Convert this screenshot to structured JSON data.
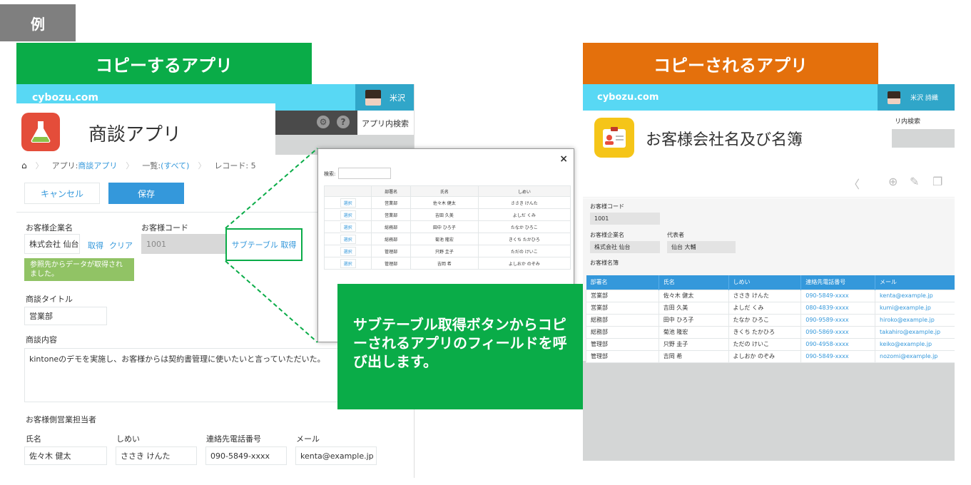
{
  "example_tag": "例",
  "left_banner": "コピーするアプリ",
  "right_banner": "コピーされるアプリ",
  "left_app": {
    "brand": "cybozu.com",
    "user": "米沢",
    "search_label": "アプリ内検索",
    "app_name": "商談アプリ",
    "breadcrumb": {
      "app_label": "アプリ:",
      "app_link": "商談アプリ",
      "list_label": "一覧:",
      "list_link": "(すべて)",
      "record": "レコード: 5"
    },
    "cancel": "キャンセル",
    "save": "保存",
    "company_name_label": "お客様企業名",
    "company_name_value": "株式会社 仙台",
    "fetch": "取得",
    "clear": "クリア",
    "customer_code_label": "お客様コード",
    "customer_code_value": "1001",
    "notice": "参照先からデータが取得されました。",
    "subtable_fetch": "サブテーブル 取得",
    "deal_title_label": "商談タイトル",
    "deal_title_value": "営業部",
    "deal_content_label": "商談内容",
    "deal_content_value": "kintoneのデモを実施し、お客様からは契約書管理に使いたいと言っていただいた。",
    "customer_rep_label": "お客様側営業担当者",
    "rep_cols": [
      "氏名",
      "しめい",
      "連絡先電話番号",
      "メール"
    ],
    "rep_values": [
      "佐々木 健太",
      "ささき けんた",
      "090-5849-xxxx",
      "kenta@example.jp"
    ]
  },
  "modal": {
    "close": "×",
    "search_label": "検索:",
    "headers": [
      "",
      "部署名",
      "氏名",
      "しめい"
    ],
    "select": "選択",
    "rows": [
      [
        "営業部",
        "佐々木 健太",
        "ささき けんた"
      ],
      [
        "営業部",
        "吉田 久美",
        "よしだ くみ"
      ],
      [
        "総務部",
        "田中 ひろ子",
        "たなか ひろこ"
      ],
      [
        "総務部",
        "菊池 隆宏",
        "きくち たかひろ"
      ],
      [
        "管理部",
        "只野 圭子",
        "ただの けいこ"
      ],
      [
        "管理部",
        "吉岡 希",
        "よしおか のぞみ"
      ]
    ]
  },
  "callout": "サブテーブル取得ボタンからコピーされるアプリのフィールドを呼び出します。",
  "right_app": {
    "brand": "cybozu.com",
    "user": "米沢 詩織",
    "search_label": "リ内検索",
    "app_name": "お客様会社名及び名簿",
    "customer_code_label": "お客様コード",
    "customer_code_value": "1001",
    "company_name_label": "お客様企業名",
    "company_name_value": "株式会社 仙台",
    "representative_label": "代表者",
    "representative_value": "仙台 大輔",
    "roster_label": "お客様名簿",
    "headers": [
      "部署名",
      "氏名",
      "しめい",
      "連絡先電話番号",
      "メール"
    ],
    "rows": [
      [
        "営業部",
        "佐々木 健太",
        "ささき けんた",
        "090-5849-xxxx",
        "kenta@example.jp"
      ],
      [
        "営業部",
        "吉田 久美",
        "よしだ くみ",
        "080-4839-xxxx",
        "kumi@example.jp"
      ],
      [
        "総務部",
        "田中 ひろ子",
        "たなか ひろこ",
        "090-9589-xxxx",
        "hiroko@example.jp"
      ],
      [
        "総務部",
        "菊池 隆宏",
        "きくち たかひろ",
        "090-5869-xxxx",
        "takahiro@example.jp"
      ],
      [
        "管理部",
        "只野 圭子",
        "ただの けいこ",
        "090-4958-xxxx",
        "keiko@example.jp"
      ],
      [
        "管理部",
        "吉岡 希",
        "よしおか のぞみ",
        "090-5849-xxxx",
        "nozomi@example.jp"
      ]
    ]
  }
}
